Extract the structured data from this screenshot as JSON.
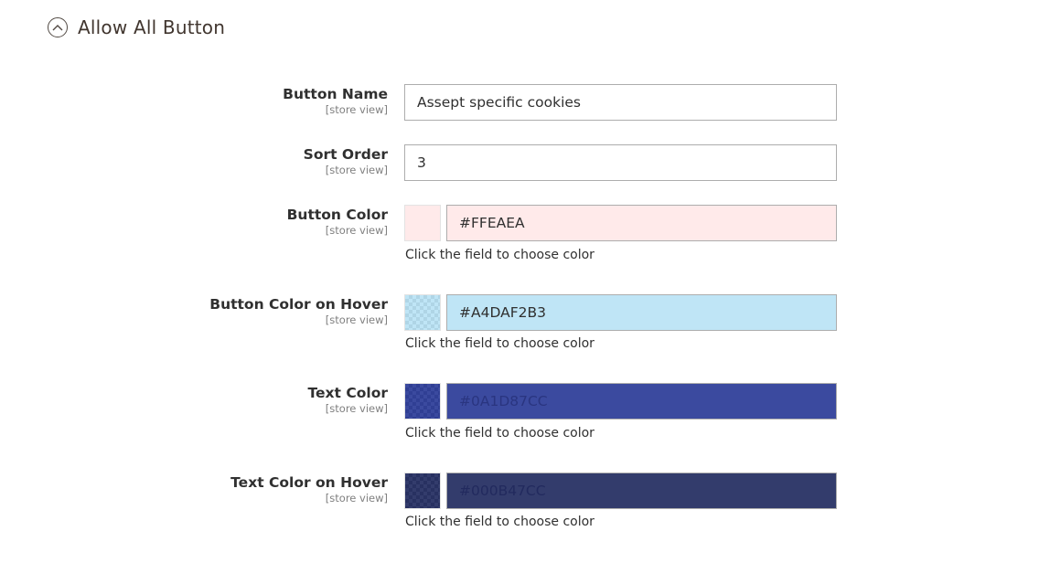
{
  "section": {
    "title": "Allow All Button"
  },
  "fields": {
    "button_name": {
      "label": "Button Name",
      "scope": "[store view]",
      "value": "Assept specific cookies"
    },
    "sort_order": {
      "label": "Sort Order",
      "scope": "[store view]",
      "value": "3"
    },
    "button_color": {
      "label": "Button Color",
      "scope": "[store view]",
      "value": "#FFEAEA",
      "swatch_color": "#FFEAEA",
      "text_color": "#303030",
      "hint": "Click the field to choose color"
    },
    "button_color_hover": {
      "label": "Button Color on Hover",
      "scope": "[store view]",
      "value": "#A4DAF2B3",
      "swatch_color": "#A4DAF2B3",
      "text_color": "#303030",
      "hint": "Click the field to choose color"
    },
    "text_color": {
      "label": "Text Color",
      "scope": "[store view]",
      "value": "#0A1D87CC",
      "swatch_color": "#0A1D87CC",
      "text_color": "#2a3580",
      "hint": "Click the field to choose color"
    },
    "text_color_hover": {
      "label": "Text Color on Hover",
      "scope": "[store view]",
      "value": "#000B47CC",
      "swatch_color": "#000B47CC",
      "text_color": "#222a5e",
      "hint": "Click the field to choose color"
    }
  }
}
